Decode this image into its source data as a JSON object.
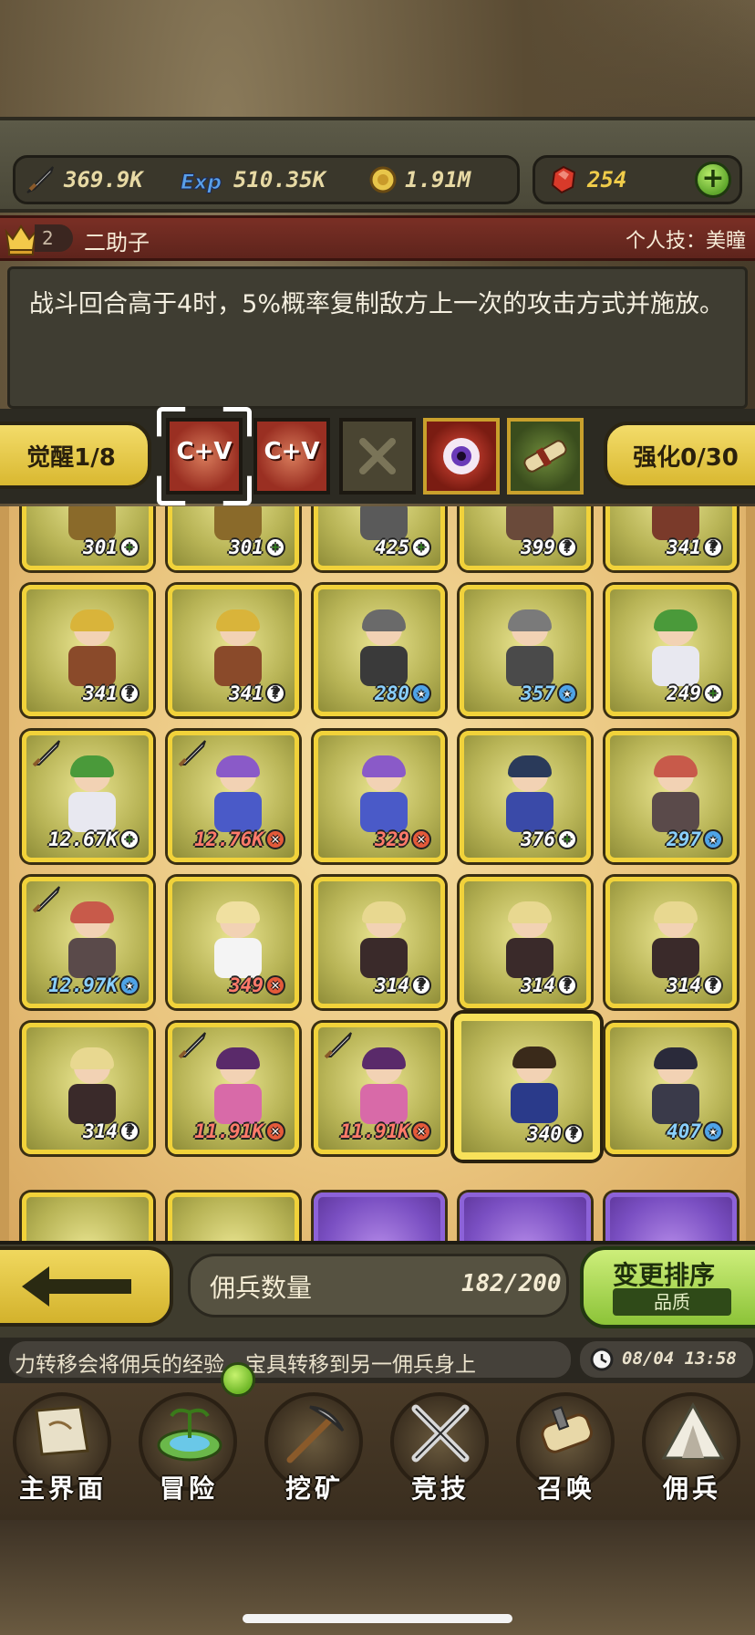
{
  "resources": {
    "power": "369.9K",
    "exp": "510.35K",
    "gold": "1.91M",
    "gems": "254"
  },
  "hero": {
    "level": "2",
    "name": "二助子",
    "skill_label": "个人技：美瞳",
    "description": "战斗回合高于4时，5%概率复制敌方上一次的攻击方式并施放。"
  },
  "skills_row": {
    "awaken": "觉醒1/8",
    "strengthen": "强化0/30",
    "cv1": "C+V",
    "cv2": "C+V"
  },
  "cards": [
    {
      "level": "301",
      "badge": "+",
      "variant": "plus",
      "hair": "#d9b43a",
      "outfit": "#8a6a2a"
    },
    {
      "level": "301",
      "badge": "+",
      "variant": "plus",
      "hair": "#d9b43a",
      "outfit": "#8a6a2a"
    },
    {
      "level": "425",
      "badge": "+",
      "variant": "plus",
      "hair": "#8a8a8a",
      "outfit": "#5a5a5a"
    },
    {
      "level": "399",
      "badge": "?",
      "variant": "q",
      "hair": "#d98a3a",
      "outfit": "#6a4a3a"
    },
    {
      "level": "341",
      "badge": "?",
      "variant": "q",
      "hair": "#c96a4a",
      "outfit": "#7a3a2a"
    },
    {
      "level": "341",
      "badge": "?",
      "variant": "q",
      "hair": "#d9b43a",
      "outfit": "#8a4a2a"
    },
    {
      "level": "341",
      "badge": "?",
      "variant": "q",
      "hair": "#d9b43a",
      "outfit": "#8a4a2a"
    },
    {
      "level": "280",
      "badge": "★",
      "variant": "star",
      "hair": "#6a6a6a",
      "outfit": "#3a3a3a"
    },
    {
      "level": "357",
      "badge": "★",
      "variant": "star",
      "hair": "#7a7a7a",
      "outfit": "#4a4a4a"
    },
    {
      "level": "249",
      "badge": "+",
      "variant": "plus",
      "hair": "#4a9a3a",
      "outfit": "#e8e8f0"
    },
    {
      "level": "12.67K",
      "badge": "+",
      "variant": "plus",
      "hair": "#4a9a3a",
      "outfit": "#e8e8f0"
    },
    {
      "level": "12.76K",
      "badge": "✕",
      "variant": "no",
      "hair": "#8a5ac8",
      "outfit": "#4a5ac8"
    },
    {
      "level": "329",
      "badge": "✕",
      "variant": "no",
      "hair": "#8a5ac8",
      "outfit": "#4a5ac8"
    },
    {
      "level": "376",
      "badge": "+",
      "variant": "plus",
      "hair": "#2a3a5a",
      "outfit": "#3a4aa8"
    },
    {
      "level": "297",
      "badge": "★",
      "variant": "star",
      "hair": "#c85a4a",
      "outfit": "#5a4a4a"
    },
    {
      "level": "12.97K",
      "badge": "★",
      "variant": "star",
      "hair": "#c85a4a",
      "outfit": "#5a4a4a"
    },
    {
      "level": "349",
      "badge": "✕",
      "variant": "no",
      "hair": "#f0e0a0",
      "outfit": "#f4f4f4"
    },
    {
      "level": "314",
      "badge": "?",
      "variant": "q",
      "hair": "#e8d890",
      "outfit": "#3a2a2a"
    },
    {
      "level": "314",
      "badge": "?",
      "variant": "q",
      "hair": "#e8d890",
      "outfit": "#3a2a2a"
    },
    {
      "level": "314",
      "badge": "?",
      "variant": "q",
      "hair": "#e8d890",
      "outfit": "#3a2a2a"
    },
    {
      "level": "314",
      "badge": "?",
      "variant": "q",
      "hair": "#e8d890",
      "outfit": "#3a2a2a"
    },
    {
      "level": "11.91K",
      "badge": "✕",
      "variant": "no",
      "hair": "#5a2a6a",
      "outfit": "#d86aa8"
    },
    {
      "level": "11.91K",
      "badge": "✕",
      "variant": "no",
      "hair": "#5a2a6a",
      "outfit": "#d86aa8"
    },
    {
      "level": "340",
      "badge": "?",
      "variant": "q",
      "hair": "#3a2a1a",
      "outfit": "#2a3a8a"
    },
    {
      "level": "407",
      "badge": "★",
      "variant": "star",
      "hair": "#2a2a3a",
      "outfit": "#3a3a4a"
    }
  ],
  "bottom": {
    "count_label": "佣兵数量",
    "count_value": "182/200",
    "sort_label": "变更排序",
    "sort_sub": "品质"
  },
  "ticker": {
    "text": "力转移会将佣兵的经验、宝具转移到另一佣兵身上",
    "time": "08/04 13:58"
  },
  "nav": [
    {
      "label": "主界面",
      "icon": "map-scroll-icon"
    },
    {
      "label": "冒险",
      "icon": "island-icon"
    },
    {
      "label": "挖矿",
      "icon": "pickaxe-icon"
    },
    {
      "label": "竞技",
      "icon": "crossed-swords-icon"
    },
    {
      "label": "召唤",
      "icon": "summon-scroll-icon"
    },
    {
      "label": "佣兵",
      "icon": "tent-icon"
    }
  ],
  "colors": {
    "accent_yellow": "#f1d23a",
    "accent_green": "#8cc338",
    "name_bar": "#7a2f25"
  }
}
